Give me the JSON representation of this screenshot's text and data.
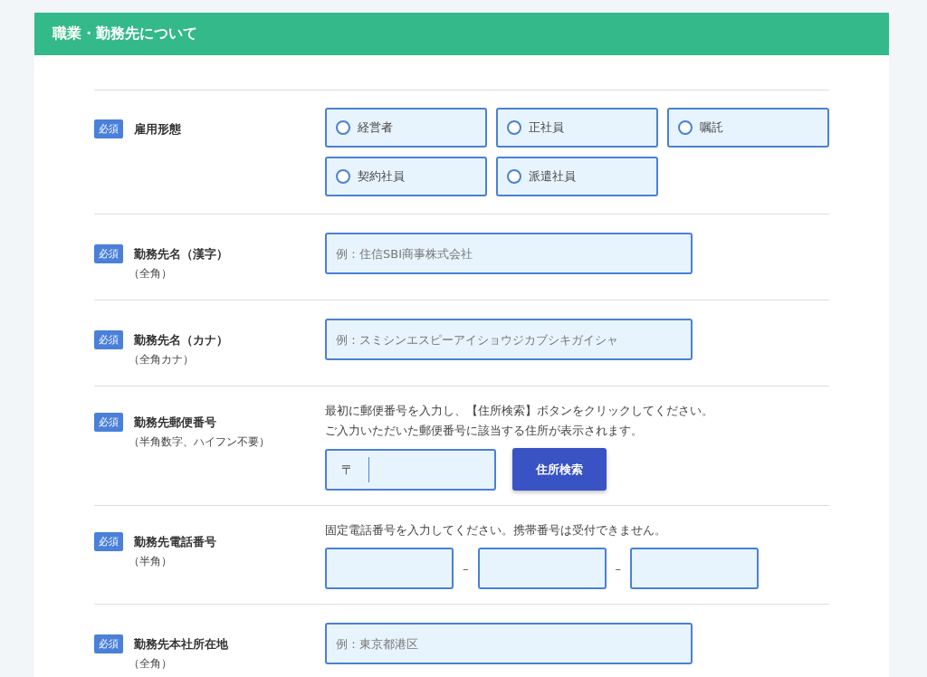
{
  "section": {
    "title": "職業・勤務先について"
  },
  "rows": [
    {
      "kind": "radio",
      "badge": "必須",
      "label": "雇用形態",
      "options": [
        {
          "label": "経営者",
          "selected": false
        },
        {
          "label": "正社員",
          "selected": false
        },
        {
          "label": "嘱託",
          "selected": false
        },
        {
          "label": "契約社員",
          "selected": false
        },
        {
          "label": "派遣社員",
          "selected": false
        }
      ]
    },
    {
      "kind": "text",
      "badge": "必須",
      "label": "勤務先名（漢字）",
      "note": "（全角）",
      "placeholder": "例：住信SBI商事株式会社"
    },
    {
      "kind": "text",
      "badge": "必須",
      "label": "勤務先名（カナ）",
      "note": "（全角カナ）",
      "placeholder": "例：スミシンエスピーアイショウジカブシキガイシャ"
    },
    {
      "kind": "postal",
      "badge": "必須",
      "label": "勤務先郵便番号",
      "note": "（半角数字、ハイフン不要）",
      "instructions": [
        "最初に郵便番号を入力し、【住所検索】ボタンをクリックしてください。",
        "ご入力いただいた郵便番号に該当する住所が表示されます。"
      ],
      "prefix": "〒",
      "button": "住所検索"
    },
    {
      "kind": "phone",
      "badge": "必須",
      "label": "勤務先電話番号",
      "note": "（半角）",
      "instructions": [
        "固定電話番号を入力してください。携帯番号は受付できません。"
      ],
      "separators": [
        "–",
        "–"
      ]
    },
    {
      "kind": "text",
      "badge": "必須",
      "label": "勤務先本社所在地",
      "note": "（全角）",
      "placeholder": "例：東京都港区"
    }
  ]
}
